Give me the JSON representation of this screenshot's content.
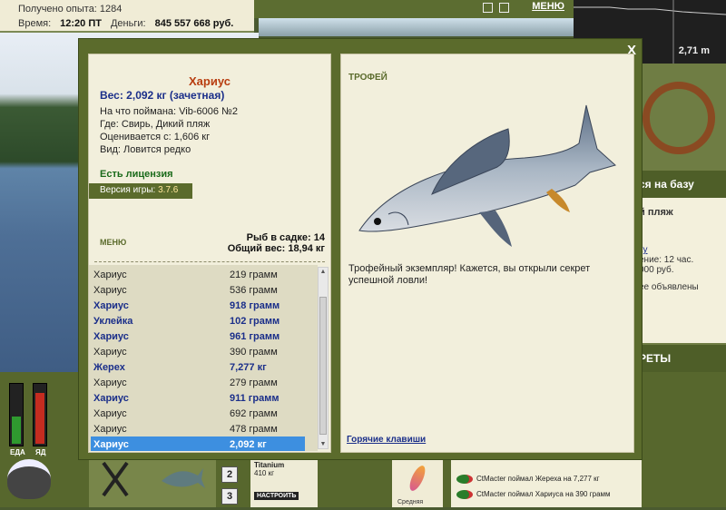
{
  "hud": {
    "exp_label": "Получено опыта: 1284",
    "time_label": "Время:",
    "time_value": "12:20 ПТ",
    "money_label": "Деньги:",
    "money_value": "845 557 668 руб.",
    "menu_label": "МЕНЮ",
    "depth": "2,71 m",
    "food_label": "ЕДА",
    "poison_label": "ЯД",
    "food_level": 0.45,
    "poison_level": 0.85
  },
  "side": {
    "base_label": "ся на базу",
    "location": "й пляж",
    "link": "ку",
    "hours": "ение: 12 час.",
    "price": "000 руб.",
    "announce": "ее объявлены",
    "secrets_label": "РЕТЫ"
  },
  "bottom": {
    "num2": "2",
    "num3": "3",
    "tackle_name": "Titanium",
    "tackle_size": "410 кг",
    "setup_label": "НАСТРОИТЬ",
    "lure_label": "Средняя",
    "feed": [
      "CtMacter поймал Жереха на 7,277 кг",
      "CtMacter поймал Хариуса на 390 грамм"
    ]
  },
  "modal": {
    "close": "X",
    "fish_name": "Хариус",
    "weight": "Вес: 2,092 кг (зачетная)",
    "caught_on": "На что поймана: Vib-6006 №2",
    "where": "Где: Свирь, Дикий пляж",
    "valued_from": "Оценивается с: 1,606 кг",
    "kind": "Вид: Ловится редко",
    "license": "Есть лицензия",
    "version_label": "Версия игры:",
    "version_value": "3.7.6",
    "menu": "МЕНЮ",
    "net_count": "Рыб в садке: 14",
    "net_weight": "Общий вес: 18,94 кг",
    "trophy": "ТРОФЕЙ",
    "caption": "Трофейный экземпляр! Кажется, вы открыли секрет успешной ловли!",
    "hotkeys": "Горячие клавиши",
    "catches": [
      {
        "name": "Хариус",
        "weight": "219 грамм",
        "bold": false
      },
      {
        "name": "Хариус",
        "weight": "536 грамм",
        "bold": false
      },
      {
        "name": "Хариус",
        "weight": "918 грамм",
        "bold": true
      },
      {
        "name": "Уклейка",
        "weight": "102 грамм",
        "bold": true
      },
      {
        "name": "Хариус",
        "weight": "961 грамм",
        "bold": true
      },
      {
        "name": "Хариус",
        "weight": "390 грамм",
        "bold": false
      },
      {
        "name": "Жерех",
        "weight": "7,277 кг",
        "bold": true
      },
      {
        "name": "Хариус",
        "weight": "279 грамм",
        "bold": false
      },
      {
        "name": "Хариус",
        "weight": "911 грамм",
        "bold": true
      },
      {
        "name": "Хариус",
        "weight": "692 грамм",
        "bold": false
      },
      {
        "name": "Хариус",
        "weight": "478 грамм",
        "bold": false
      },
      {
        "name": "Хариус",
        "weight": "2,092 кг",
        "bold": true,
        "selected": true
      }
    ]
  }
}
